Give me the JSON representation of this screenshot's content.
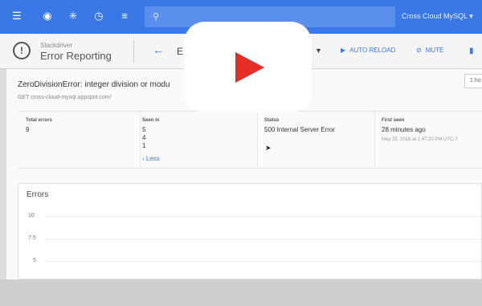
{
  "project": {
    "label": "Cross Cloud MySQL ▾"
  },
  "header": {
    "brand": "Stackdriver",
    "app": "Error Reporting",
    "group_label": "E",
    "actions": [
      {
        "icon": "play-icon",
        "label": "AUTO RELOAD"
      },
      {
        "icon": "mute-icon",
        "label": "MUTE"
      }
    ]
  },
  "error": {
    "title": "ZeroDivisionError: integer division or modu",
    "url": "GET cross-cloud-mysql.appspot.com/",
    "time_range": "1 ho"
  },
  "stats": {
    "total_errors_label": "Total errors",
    "total_errors_value": "9",
    "seen_in_label": "Seen in",
    "seen_in_values": [
      "5",
      "4",
      "1"
    ],
    "less_label": "Less",
    "status_label": "Status",
    "status_value": "500 Internal Server Error",
    "first_seen_label": "First seen",
    "first_seen_value": "28 minutes ago",
    "first_seen_date": "May 25, 2016 at 1:47:20 PM UTC-7"
  },
  "errors_chart": {
    "title": "Errors",
    "ticks": [
      "10",
      "7.5",
      "5"
    ]
  },
  "colors": {
    "topbar": "#3b78e7",
    "accent": "#3b78e7",
    "play": "#e52d27"
  }
}
